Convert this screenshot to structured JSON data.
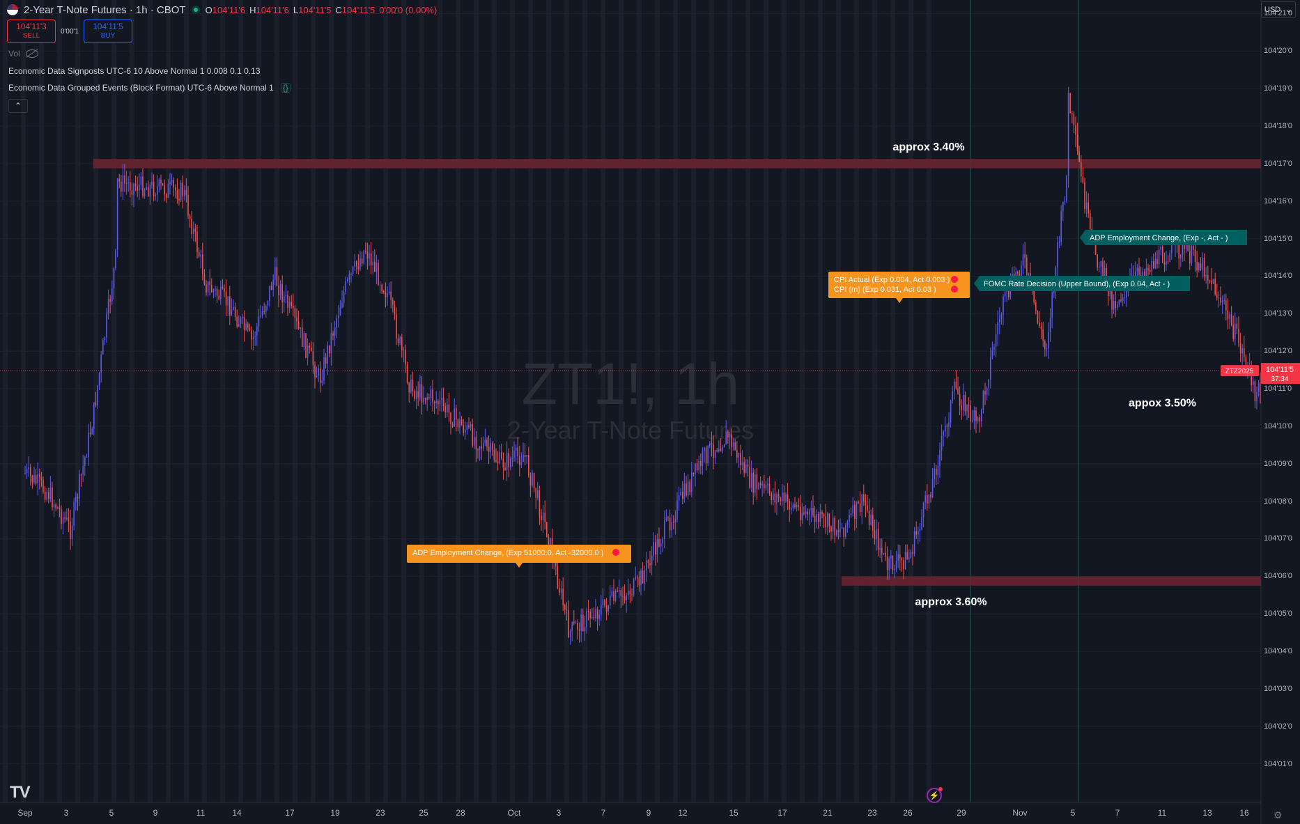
{
  "header": {
    "title": "2-Year T-Note Futures · 1h · CBOT",
    "ohlc": [
      {
        "k": "O",
        "v": "104'11'6"
      },
      {
        "k": "H",
        "v": "104'11'6"
      },
      {
        "k": "L",
        "v": "104'11'5"
      },
      {
        "k": "C",
        "v": "104'11'5"
      }
    ],
    "change": "0'00'0 (0.00%)"
  },
  "trade": {
    "sell_price": "104'11'3",
    "sell_label": "SELL",
    "spread": "0'00'1",
    "buy_price": "104'11'5",
    "buy_label": "BUY"
  },
  "volume_label": "Vol",
  "indicators": [
    "Economic Data Signposts UTC-6 10 Above Normal 1 0.008 0.1 0.13",
    "Economic Data Grouped Events (Block Format) UTC-6 Above Normal 1"
  ],
  "currency": "USD",
  "watermark": {
    "symbol": "ZT1!, 1h",
    "name": "2-Year T-Note Futures"
  },
  "colors": {
    "background": "#131722",
    "up": "#5b5cf0",
    "down": "#ef5350",
    "zone": "#6e2530",
    "event_orange": "#f7941d",
    "event_teal": "#006060",
    "price_tag": "#f23645"
  },
  "chart_data": {
    "type": "candlestick",
    "symbol": "ZT1!",
    "interval": "1h",
    "price_scale_format": "32nds with quarter fractions",
    "x_ticks": [
      "Sep",
      "3",
      "5",
      "9",
      "11",
      "14",
      "17",
      "19",
      "23",
      "25",
      "28",
      "Oct",
      "3",
      "7",
      "9",
      "12",
      "15",
      "17",
      "21",
      "23",
      "26",
      "29",
      "Nov",
      "5",
      "7",
      "11",
      "13",
      "16"
    ],
    "y_ticks": [
      "104'21'0",
      "104'20'0",
      "104'19'0",
      "104'18'0",
      "104'17'0",
      "104'16'0",
      "104'15'0",
      "104'14'0",
      "104'13'0",
      "104'12'0",
      "104'11'0",
      "104'10'0",
      "104'09'0",
      "104'08'0",
      "104'07'0",
      "104'06'0",
      "104'05'0",
      "104'04'0",
      "104'03'0",
      "104'02'0",
      "104'01'0"
    ],
    "price_path": [
      {
        "date": "Sep 1",
        "price": 104.2734
      },
      {
        "date": "Sep 2",
        "price": 104.2578
      },
      {
        "date": "Sep 3",
        "price": 104.2266
      },
      {
        "date": "Sep 4",
        "price": 104.3203
      },
      {
        "date": "Sep 5",
        "price": 104.4531
      },
      {
        "date": "Sep 5",
        "price": 104.5156
      },
      {
        "date": "Sep 8",
        "price": 104.5078
      },
      {
        "date": "Sep 9",
        "price": 104.4297
      },
      {
        "date": "Sep 10",
        "price": 104.4141
      },
      {
        "date": "Sep 11",
        "price": 104.3828
      },
      {
        "date": "Sep 12",
        "price": 104.4375
      },
      {
        "date": "Sep 14",
        "price": 104.3516
      },
      {
        "date": "Sep 15",
        "price": 104.4219
      },
      {
        "date": "Sep 16",
        "price": 104.4609
      },
      {
        "date": "Sep 17",
        "price": 104.4219
      },
      {
        "date": "Sep 18",
        "price": 104.3438
      },
      {
        "date": "Sep 19",
        "price": 104.3359
      },
      {
        "date": "Sep 22",
        "price": 104.2813
      },
      {
        "date": "Sep 23",
        "price": 104.2891
      },
      {
        "date": "Sep 24",
        "price": 104.2266
      },
      {
        "date": "Sep 25",
        "price": 104.1406
      },
      {
        "date": "Sep 26",
        "price": 104.1563
      },
      {
        "date": "Sep 28",
        "price": 104.1797
      },
      {
        "date": "Sep 29",
        "price": 104.2188
      },
      {
        "date": "Oct 1",
        "price": 104.2891
      },
      {
        "date": "Oct 2",
        "price": 104.3047
      },
      {
        "date": "Oct 3",
        "price": 104.2656
      },
      {
        "date": "Oct 6",
        "price": 104.2344
      },
      {
        "date": "Oct 7",
        "price": 104.2266
      },
      {
        "date": "Oct 8",
        "price": 104.25
      },
      {
        "date": "Oct 9",
        "price": 104.1953
      },
      {
        "date": "Oct 10",
        "price": 104.2031
      },
      {
        "date": "Oct 11",
        "price": 104.2656
      },
      {
        "date": "Oct 12",
        "price": 104.3438
      },
      {
        "date": "Oct 13",
        "price": 104.3125
      },
      {
        "date": "Oct 14",
        "price": 104.4063
      },
      {
        "date": "Oct 15",
        "price": 104.4531
      },
      {
        "date": "Oct 16",
        "price": 104.375
      },
      {
        "date": "Oct 17",
        "price": 104.5313
      },
      {
        "date": "Oct 17",
        "price": 104.5859
      },
      {
        "date": "Oct 18",
        "price": 104.4688
      },
      {
        "date": "Oct 19",
        "price": 104.4141
      },
      {
        "date": "Oct 20",
        "price": 104.4375
      },
      {
        "date": "Oct 21",
        "price": 104.4531
      },
      {
        "date": "Oct 22",
        "price": 104.4609
      },
      {
        "date": "Oct 23",
        "price": 104.4453
      },
      {
        "date": "Oct 24",
        "price": 104.4063
      },
      {
        "date": "Oct 25",
        "price": 104.3594
      },
      {
        "date": "Oct 25",
        "price": 104.3438
      },
      {
        "date": "Oct 26",
        "price": 104.3359
      },
      {
        "date": "Oct 27",
        "price": 104.3594
      }
    ],
    "zones": [
      {
        "label": "approx 3.40%",
        "price_low": 104.5273,
        "price_high": 104.5352,
        "from": "Sep 4",
        "to": "Nov 12"
      },
      {
        "label": "approx 3.60%",
        "price_low": 104.1797,
        "price_high": 104.1875,
        "from": "Oct 7",
        "to": "Nov 13"
      }
    ],
    "annotations": [
      {
        "label": "appox 3.50%",
        "date": "Oct 21",
        "price": 104.3516
      }
    ],
    "events": [
      {
        "type": "grouped",
        "date": "Oct 1",
        "price": 104.2422,
        "text": "ADP Employment Change, (Exp 51000.0, Act -32000.0 )"
      },
      {
        "type": "grouped",
        "date": "Oct 24",
        "price": 104.4609,
        "lines": [
          "CPI Actual (Exp 0.004, Act 0.003 )",
          "CPI (m) (Exp 0.031, Act 0.03 )"
        ]
      },
      {
        "type": "signpost",
        "date": "Oct 29",
        "price": 104.4609,
        "text": "FOMC Rate Decision (Upper Bound), (Exp 0.04, Act - )"
      },
      {
        "type": "signpost",
        "date": "Nov 5",
        "price": 104.5,
        "text": "ADP Employment Change, (Exp -, Act - )"
      }
    ],
    "last_price": {
      "label": "ZTZ2025",
      "price_text": "104'11'5",
      "countdown": "37:34",
      "price": 104.3594
    },
    "grid": true,
    "legend": "top-left"
  }
}
